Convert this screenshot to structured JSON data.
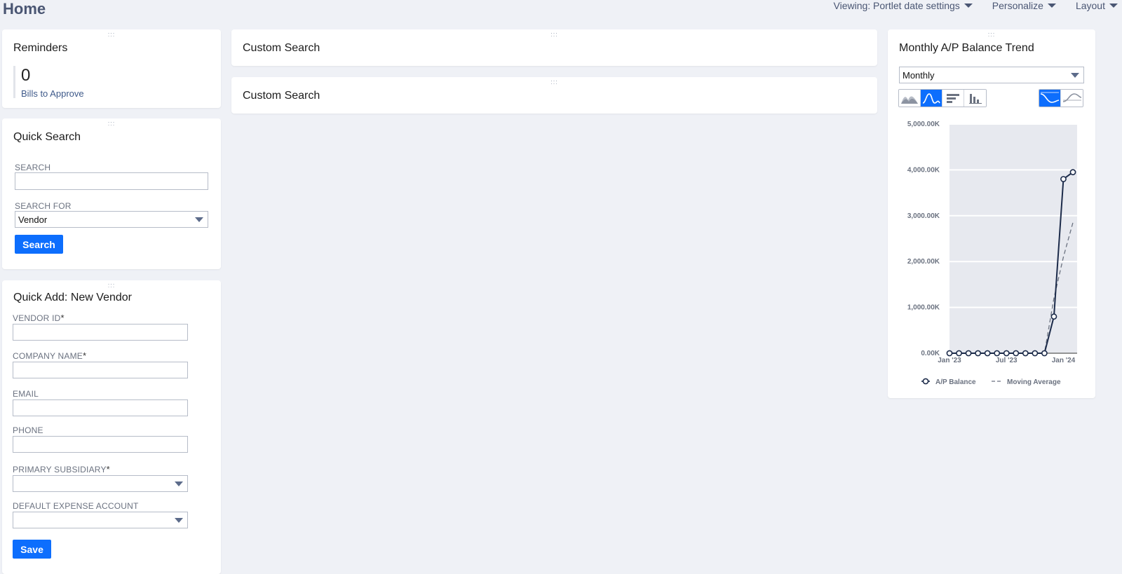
{
  "page": {
    "title": "Home"
  },
  "top_nav": {
    "viewing": "Viewing: Portlet date settings",
    "personalize": "Personalize",
    "layout": "Layout"
  },
  "reminders": {
    "title": "Reminders",
    "count": "0",
    "label": "Bills to Approve"
  },
  "quick_search": {
    "title": "Quick Search",
    "search_label": "SEARCH",
    "search_value": "",
    "search_for_label": "SEARCH FOR",
    "search_for_value": "Vendor",
    "button": "Search"
  },
  "quick_add": {
    "title": "Quick Add: New Vendor",
    "fields": {
      "vendor_id": "VENDOR ID",
      "company_name": "COMPANY NAME",
      "email": "EMAIL",
      "phone": "PHONE",
      "primary_subsidiary": "PRIMARY SUBSIDIARY",
      "default_expense_account": "DEFAULT EXPENSE ACCOUNT"
    },
    "required_mark": "*",
    "button": "Save"
  },
  "custom_search": {
    "title_1": "Custom Search",
    "title_2": "Custom Search"
  },
  "trend": {
    "title": "Monthly A/P Balance Trend",
    "period_value": "Monthly"
  },
  "colors": {
    "accent": "#0d6efd",
    "series": "#1c2b4a",
    "moving_avg": "#6b7280"
  },
  "chart_data": {
    "type": "line",
    "x": [
      "Jan '23",
      "Feb '23",
      "Mar '23",
      "Apr '23",
      "May '23",
      "Jun '23",
      "Jul '23",
      "Aug '23",
      "Sep '23",
      "Oct '23",
      "Nov '23",
      "Dec '23",
      "Jan '24",
      "Feb '24"
    ],
    "x_tick_labels": [
      "Jan '23",
      "Jul '23",
      "Jan '24"
    ],
    "y_tick_labels": [
      "0.00K",
      "1,000.00K",
      "2,000.00K",
      "3,000.00K",
      "4,000.00K",
      "5,000.00K"
    ],
    "ylim": [
      0,
      5000
    ],
    "grid": true,
    "legend": "bottom",
    "series": [
      {
        "name": "A/P Balance",
        "values": [
          0,
          0,
          0,
          0,
          0,
          0,
          0,
          0,
          0,
          0,
          0,
          800,
          3800,
          3950
        ]
      },
      {
        "name": "Moving Average",
        "values": [
          0,
          0,
          0,
          0,
          0,
          0,
          0,
          0,
          0,
          0,
          0,
          1200,
          2100,
          2850
        ]
      }
    ]
  }
}
